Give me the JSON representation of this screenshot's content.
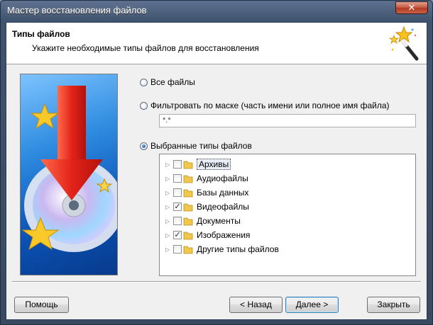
{
  "window": {
    "title": "Мастер восстановления файлов",
    "close_label": "✕"
  },
  "header": {
    "title": "Типы файлов",
    "subtitle": "Укажите необходимые типы файлов для восстановления"
  },
  "options": {
    "all_files": {
      "label": "Все файлы",
      "selected": false
    },
    "filter_mask": {
      "label": "Фильтровать по маске (часть имени или полное имя файла)",
      "selected": false,
      "value": "*.*"
    },
    "selected_types": {
      "label": "Выбранные типы файлов",
      "selected": true
    }
  },
  "tree": {
    "items": [
      {
        "label": "Архивы",
        "checked": false
      },
      {
        "label": "Аудиофайлы",
        "checked": false
      },
      {
        "label": "Базы данных",
        "checked": false
      },
      {
        "label": "Видеофайлы",
        "checked": true
      },
      {
        "label": "Документы",
        "checked": false
      },
      {
        "label": "Изображения",
        "checked": true
      },
      {
        "label": "Другие типы файлов",
        "checked": false
      }
    ]
  },
  "buttons": {
    "help": "Помощь",
    "back": "< Назад",
    "next": "Далее >",
    "close": "Закрыть"
  }
}
